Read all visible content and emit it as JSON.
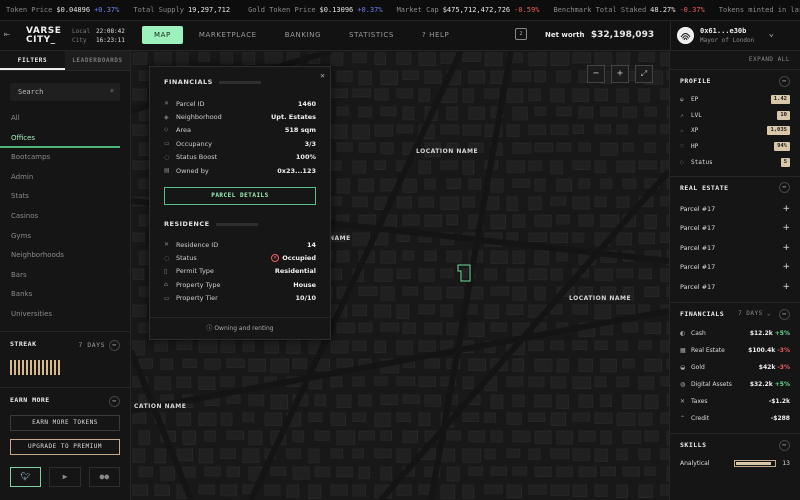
{
  "ticker": [
    {
      "label": "Token Price",
      "value": "$0.04896",
      "change": "+0.37%",
      "dir": "up"
    },
    {
      "label": "Total Supply",
      "value": "19,297,712",
      "change": "",
      "dir": ""
    },
    {
      "label": "Gold Token Price",
      "value": "$0.13096",
      "change": "+0.37%",
      "dir": "up"
    },
    {
      "label": "Market Cap",
      "value": "$475,712,472,726",
      "change": "-0.59%",
      "dir": "down"
    },
    {
      "label": "Benchmark Total Staked",
      "value": "48.27%",
      "change": "-0.37%",
      "dir": "down"
    },
    {
      "label": "Tokens minted in last block",
      "value": "",
      "change": "",
      "dir": ""
    }
  ],
  "header": {
    "logo_line1": "VARSE",
    "logo_line2": "CITY_",
    "local_label": "Local",
    "local_time": "22:08:42",
    "city_label": "City",
    "city_time": "16:23:11",
    "nav": [
      {
        "label": "MAP",
        "active": true
      },
      {
        "label": "MARKETPLACE",
        "active": false
      },
      {
        "label": "BANKING",
        "active": false
      },
      {
        "label": "STATISTICS",
        "active": false
      },
      {
        "label": "? HELP",
        "active": false
      }
    ],
    "messages_count": "2",
    "networth_label": "Net worth",
    "networth_value": "$32,198,093",
    "user_name": "0x61...e30b",
    "user_role": "Mayor of London"
  },
  "left": {
    "tabs": [
      "FILTERS",
      "LEADERBOARDS"
    ],
    "search_placeholder": "Search",
    "filters": [
      "All",
      "Offices",
      "Bootcamps",
      "Admin",
      "Stats",
      "Casinos",
      "Gyms",
      "Neighborhoods",
      "Bars",
      "Banks",
      "Universities"
    ],
    "active_filter": "Offices",
    "streak_label": "STREAK",
    "streak_value": "7 DAYS",
    "earn_label": "EARN MORE",
    "earn_tokens": "EARN MORE TOKENS",
    "upgrade": "UPGRADE TO PREMIUM"
  },
  "map": {
    "labels": [
      "LOCATION NAME",
      "LOCATION NAME",
      "CATION NAME",
      "NAME"
    ]
  },
  "popup": {
    "financials_title": "FINANCIALS",
    "financials": [
      {
        "icon": "✕",
        "key": "Parcel ID",
        "value": "1460"
      },
      {
        "icon": "◈",
        "key": "Neighborhood",
        "value": "Upt. Estates"
      },
      {
        "icon": "⬦",
        "key": "Area",
        "value": "518 sqm"
      },
      {
        "icon": "▭",
        "key": "Occupancy",
        "value": "3/3"
      },
      {
        "icon": "◌",
        "key": "Status Boost",
        "value": "100%"
      },
      {
        "icon": "▤",
        "key": "Owned by",
        "value": "0x23...123"
      }
    ],
    "details_button": "PARCEL DETAILS",
    "residence_title": "RESIDENCE",
    "residence": [
      {
        "icon": "✕",
        "key": "Residence ID",
        "value": "14"
      },
      {
        "icon": "◌",
        "key": "Status",
        "value": "Occupied"
      },
      {
        "icon": "▯",
        "key": "Permit Type",
        "value": "Residential"
      },
      {
        "icon": "⌂",
        "key": "Property Type",
        "value": "House"
      },
      {
        "icon": "▭",
        "key": "Property Tier",
        "value": "10/10"
      }
    ],
    "footer": "Owning and renting"
  },
  "right": {
    "expand": "EXPAND ALL",
    "profile_title": "PROFILE",
    "profile": [
      {
        "icon": "◒",
        "key": "EP",
        "value": "1.42"
      },
      {
        "icon": "↗",
        "key": "LVL",
        "value": "10"
      },
      {
        "icon": "☆",
        "key": "XP",
        "value": "1,035"
      },
      {
        "icon": "♡",
        "key": "HP",
        "value": "94%"
      },
      {
        "icon": "◌",
        "key": "Status",
        "value": "5"
      }
    ],
    "realestate_title": "REAL ESTATE",
    "parcels": [
      "Parcel #17",
      "Parcel #17",
      "Parcel #17",
      "Parcel #17",
      "Parcel #17"
    ],
    "financials_title": "FINANCIALS",
    "financials_period": "7 DAYS",
    "financials": [
      {
        "icon": "◐",
        "key": "Cash",
        "value": "$12.2k",
        "change": "+5%",
        "dir": "up"
      },
      {
        "icon": "▦",
        "key": "Real Estate",
        "value": "$100.4k",
        "change": "-3%",
        "dir": "down"
      },
      {
        "icon": "◒",
        "key": "Gold",
        "value": "$42k",
        "change": "-3%",
        "dir": "down"
      },
      {
        "icon": "◍",
        "key": "Digital Assets",
        "value": "$32.2k",
        "change": "+5%",
        "dir": "up"
      },
      {
        "icon": "✕",
        "key": "Taxes",
        "value": "-$1.2k",
        "change": "",
        "dir": ""
      },
      {
        "icon": "⌃",
        "key": "Credit",
        "value": "-$288",
        "change": "",
        "dir": ""
      }
    ],
    "skills_title": "SKILLS",
    "skills": [
      {
        "key": "Analytical",
        "value": "13",
        "level": 0.92
      }
    ]
  }
}
